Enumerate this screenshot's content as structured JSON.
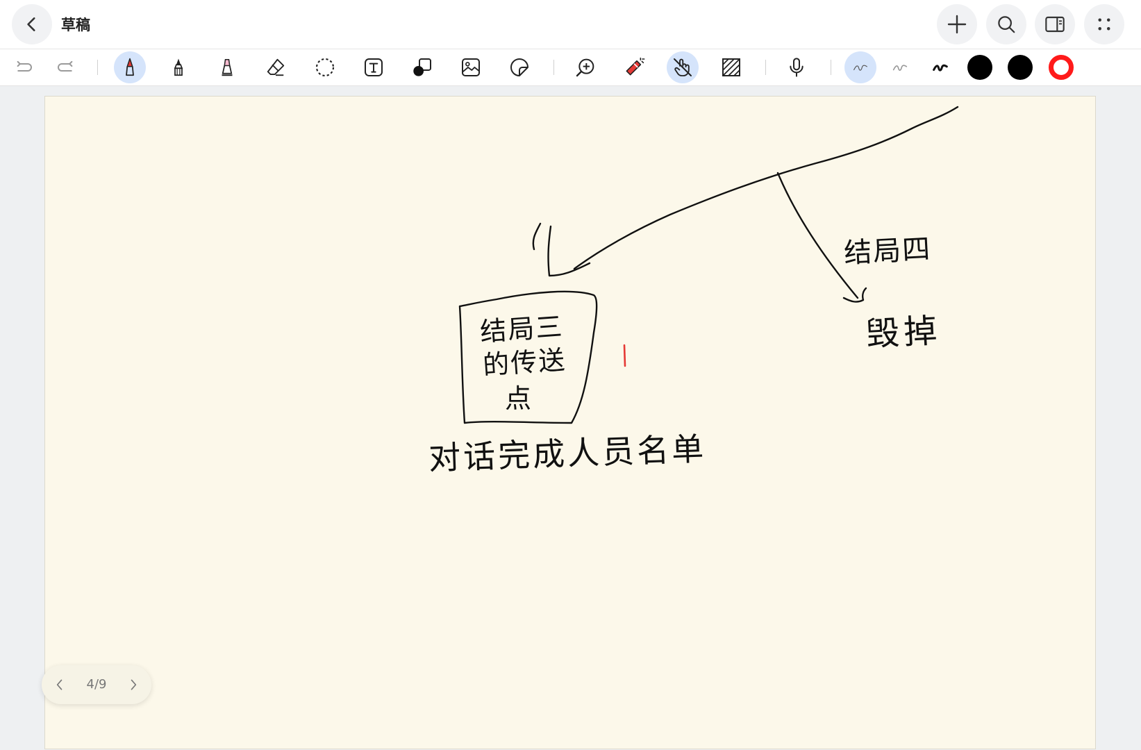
{
  "app": {
    "title": "草稿"
  },
  "icons": {
    "back": "chevron-left-icon",
    "add": "plus-icon",
    "search": "search-icon",
    "panel": "split-view-icon",
    "more": "grid-dots-icon"
  },
  "toolbar": {
    "tools": [
      "undo",
      "redo",
      "pen",
      "brush",
      "highlighter",
      "eraser",
      "lasso-select",
      "text",
      "shapes",
      "image",
      "sticker",
      "zoom",
      "laser-pointer",
      "touch-draw",
      "pattern-fill",
      "microphone",
      "stroke-thin",
      "stroke-medium",
      "stroke-thick"
    ],
    "active_tools": [
      "pen",
      "touch-draw",
      "stroke-thin"
    ],
    "colors": [
      "#000000",
      "#000000",
      "#ff1a1a"
    ]
  },
  "canvas": {
    "background": "#fcf8ea",
    "handwriting": {
      "box_text_line1": "结局三",
      "box_text_line2": "的传送",
      "box_text_line3": "点",
      "caption": "对话完成人员名单",
      "branch_label": "结局四",
      "branch_target": "毁掉"
    }
  },
  "pager": {
    "text": "4/9"
  }
}
